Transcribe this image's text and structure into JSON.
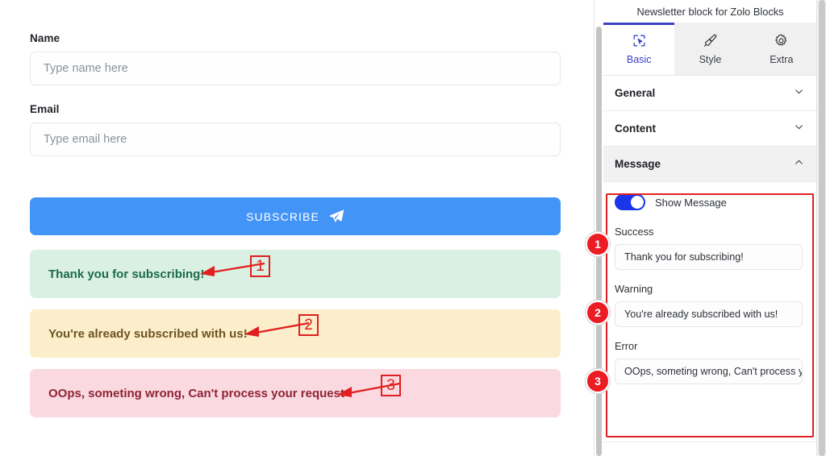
{
  "preview": {
    "name_label": "Name",
    "name_placeholder": "Type name here",
    "email_label": "Email",
    "email_placeholder": "Type email here",
    "subscribe_label": "SUBSCRIBE",
    "subscribe_icon": "paper-plane-icon",
    "alerts": [
      {
        "type": "success",
        "text": "Thank you for subscribing!"
      },
      {
        "type": "warning",
        "text": "You're already subscribed with us!"
      },
      {
        "type": "error",
        "text": "OOps, someting wrong, Can't process your request"
      }
    ],
    "colors": {
      "subscribe_bg": "#4294f7",
      "success_bg": "#d9f0e2",
      "success_text": "#1d6b4a",
      "warning_bg": "#fdeecb",
      "warning_text": "#6d5420",
      "error_bg": "#fbd9e0",
      "error_text": "#8e2436"
    }
  },
  "annotations": {
    "color": "#e02020",
    "markers": [
      {
        "number": "1",
        "target": "success-alert"
      },
      {
        "number": "2",
        "target": "warning-alert"
      },
      {
        "number": "3",
        "target": "error-alert"
      }
    ]
  },
  "panel": {
    "title": "Newsletter block for Zolo Blocks",
    "tabs": [
      {
        "label": "Basic",
        "icon": "cursor-select-icon",
        "active": true
      },
      {
        "label": "Style",
        "icon": "paintbrush-icon",
        "active": false
      },
      {
        "label": "Extra",
        "icon": "gear-icon",
        "active": false
      }
    ],
    "accordions": [
      {
        "label": "General",
        "expanded": false,
        "icon": "chevron-down-icon"
      },
      {
        "label": "Content",
        "expanded": false,
        "icon": "chevron-down-icon"
      },
      {
        "label": "Message",
        "expanded": true,
        "icon": "chevron-up-icon"
      }
    ],
    "message_section": {
      "toggle_label": "Show Message",
      "toggle_on": true,
      "toggle_color": "#1b35e8",
      "fields": [
        {
          "label": "Success",
          "value": "Thank you for subscribing!",
          "badge": "1"
        },
        {
          "label": "Warning",
          "value": "You're already subscribed with us!",
          "badge": "2"
        },
        {
          "label": "Error",
          "value": "OOps, someting wrong, Can't process your request",
          "badge": "3"
        }
      ]
    },
    "badge_color": "#ec1c24",
    "accent_color": "#3b43c4"
  }
}
